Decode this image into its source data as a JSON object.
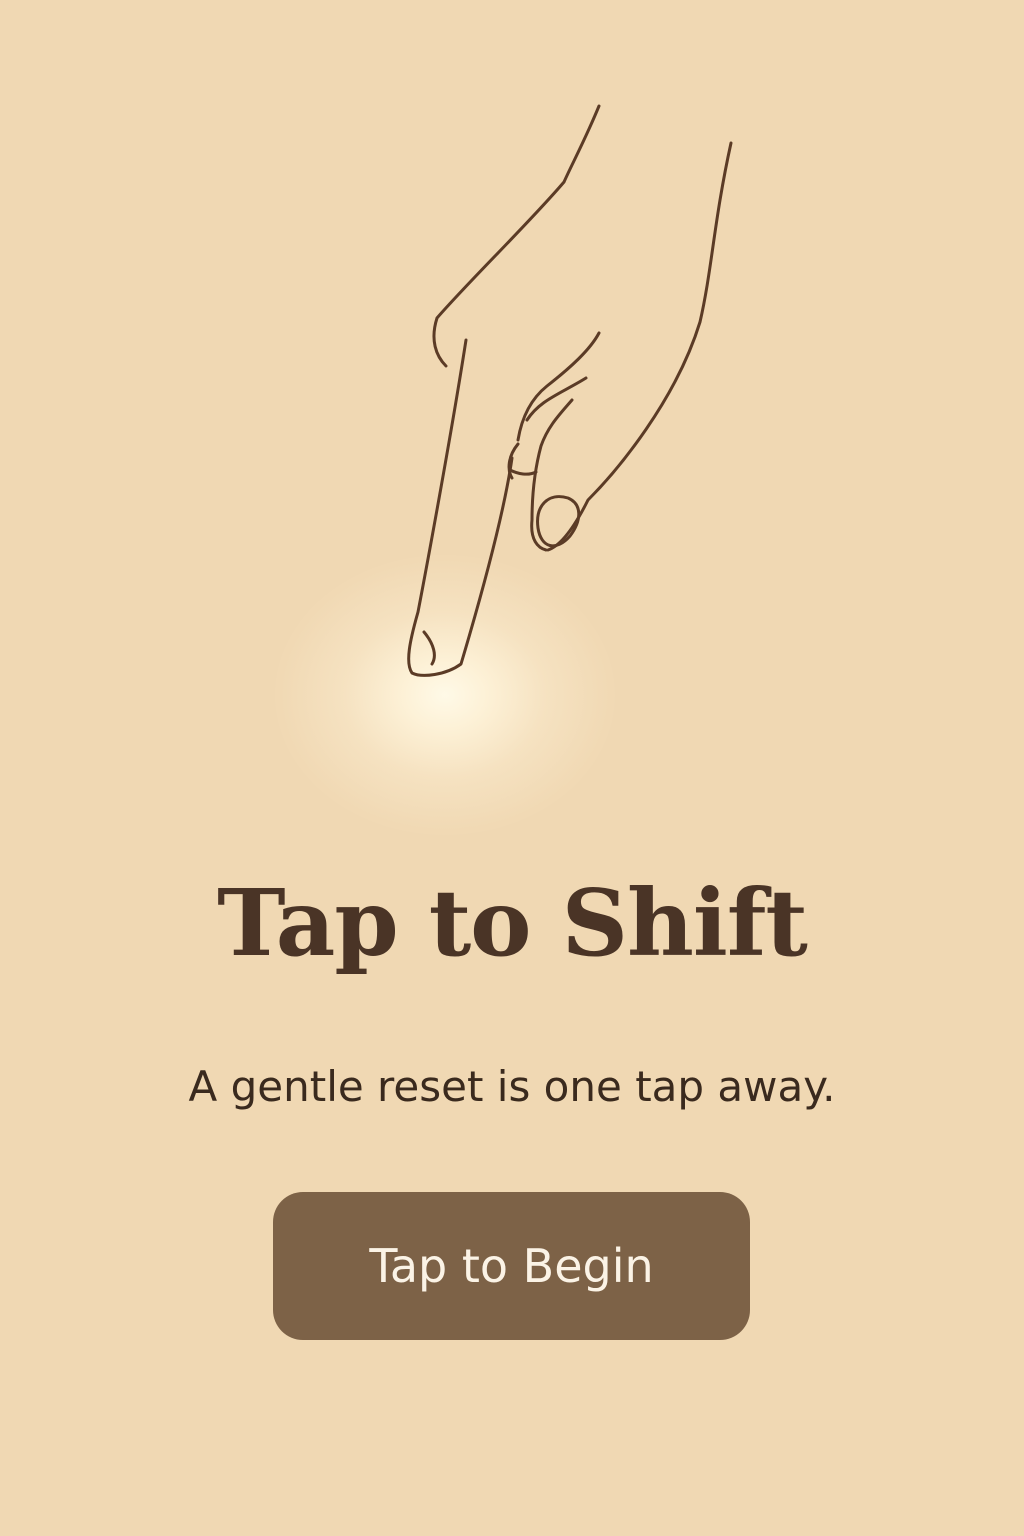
{
  "screen": {
    "title": "Tap to Shift",
    "subtitle": "A gentle reset is one tap away.",
    "cta_label": "Tap to Begin",
    "illustration_icon": "pointing-hand-icon"
  },
  "colors": {
    "background": "#F0D8B3",
    "title_text": "#4A3426",
    "body_text": "#3A2A1E",
    "button_background": "#7D6247",
    "button_text": "#FBF3E6",
    "illustration_stroke": "#5B3B26",
    "glow": "#FFF8E6"
  }
}
